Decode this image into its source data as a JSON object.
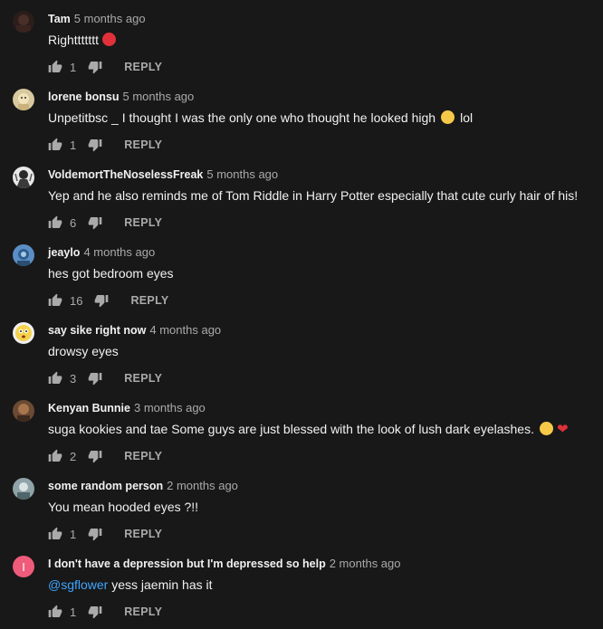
{
  "comments": [
    {
      "author": "Tam",
      "time": "5 months ago",
      "text": "Righttttttt",
      "emoji": [
        "angry-face-emoji"
      ],
      "likes": "1",
      "reply_label": "REPLY",
      "avatar": "dark-avatar"
    },
    {
      "author": "lorene bonsu",
      "time": "5 months ago",
      "text": "Unpetitbsc _ I thought I was the only one who thought he looked high",
      "text_after": "lol",
      "emoji": [
        "grinning-sweat-emoji"
      ],
      "likes": "1",
      "reply_label": "REPLY",
      "avatar": "cartoon-avatar"
    },
    {
      "author": "VoldemortTheNoselessFreak",
      "time": "5 months ago",
      "text": "Yep and he also reminds me of Tom Riddle in Harry Potter especially that cute curly hair of his!",
      "likes": "6",
      "reply_label": "REPLY",
      "avatar": "person-avatar"
    },
    {
      "author": "jeaylo",
      "time": "4 months ago",
      "text": "hes got bedroom eyes",
      "likes": "16",
      "reply_label": "REPLY",
      "avatar": "blue-avatar"
    },
    {
      "author": "say sike right now",
      "time": "4 months ago",
      "text": "drowsy eyes",
      "likes": "3",
      "reply_label": "REPLY",
      "avatar": "face-avatar"
    },
    {
      "author": "Kenyan Bunnie",
      "time": "3 months ago",
      "text": "suga kookies and tae Some guys are just blessed with the look of lush dark eyelashes.",
      "emoji": [
        "crying-face-emoji",
        "red-heart-emoji"
      ],
      "likes": "2",
      "reply_label": "REPLY",
      "avatar": "brown-avatar"
    },
    {
      "author": "some random person",
      "time": "2 months ago",
      "text": "You mean hooded eyes ?!!",
      "likes": "1",
      "reply_label": "REPLY",
      "avatar": "grey-avatar"
    },
    {
      "author": "I don't have a depression but I'm depressed so help",
      "time": "2 months ago",
      "mention": "@sgflower",
      "text": " yess jaemin has it",
      "likes": "1",
      "reply_label": "REPLY",
      "avatar_letter": "I",
      "avatar": "letter-avatar"
    }
  ],
  "colors": {
    "background": "#181818",
    "primary_text": "#f1f1f1",
    "secondary_text": "#aaaaaa",
    "mention": "#3ea6ff",
    "letter_avatar": "#ef5b7a"
  },
  "icons": {
    "like": "thumbs-up-icon",
    "dislike": "thumbs-down-icon"
  }
}
